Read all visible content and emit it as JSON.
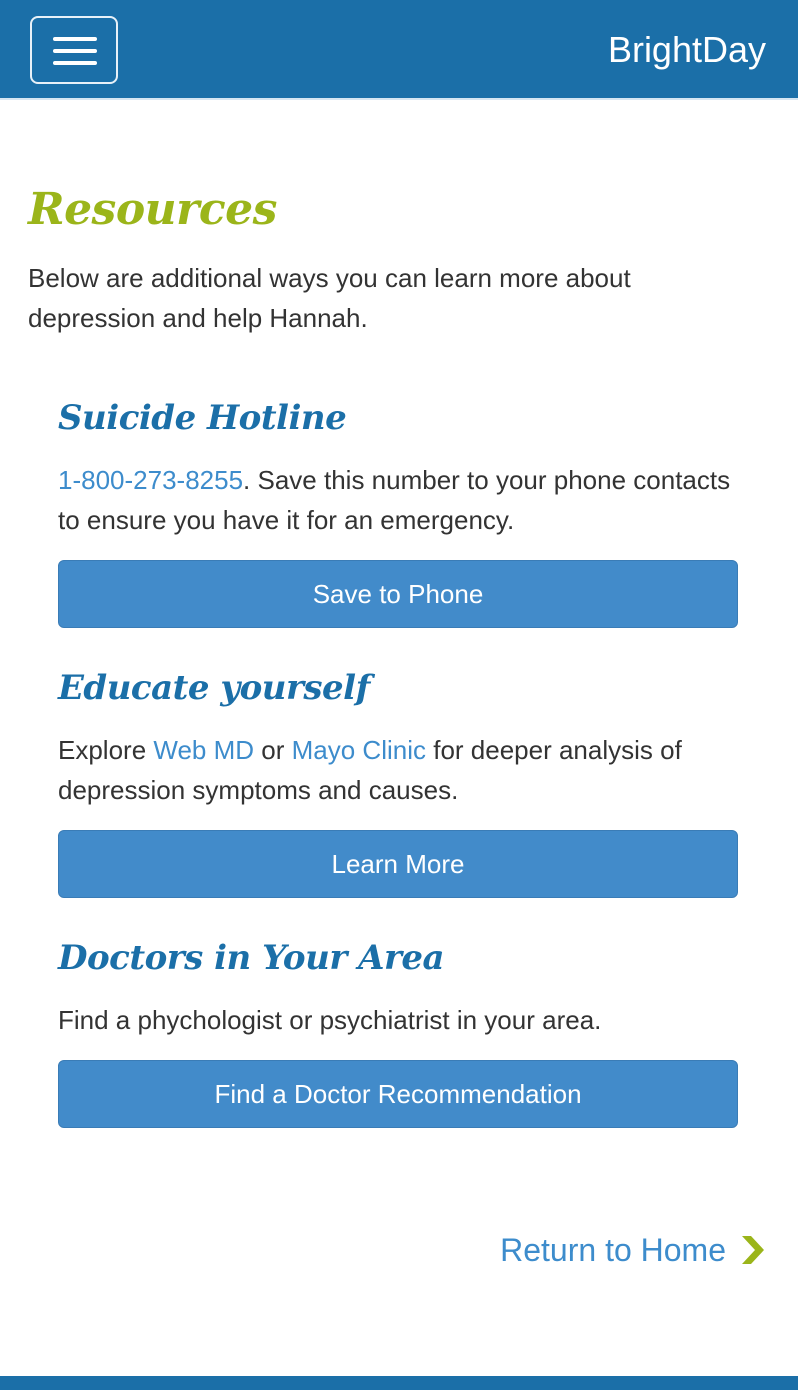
{
  "header": {
    "brand": "BrightDay",
    "menu_icon": "hamburger-menu-icon"
  },
  "main": {
    "title": "Resources",
    "intro": "Below are additional ways you can learn more about depression and help Hannah."
  },
  "sections": [
    {
      "heading": "Suicide Hotline",
      "phone_link": "1-800-273-8255",
      "text_after_link": ". Save this number to your phone contacts to ensure you have it for an emergency.",
      "button_label": "Save to Phone"
    },
    {
      "heading": "Educate yourself",
      "text_before": "Explore ",
      "link1": "Web MD",
      "text_between": " or ",
      "link2": "Mayo Clinic",
      "text_after": " for deeper analysis of depression symptoms and causes.",
      "button_label": "Learn More"
    },
    {
      "heading": "Doctors in Your Area",
      "text": "Find a phychologist or psychiatrist in your area.",
      "button_label": "Find a Doctor Recommendation"
    }
  ],
  "footer": {
    "return_label": "Return to Home",
    "return_icon": "chevron-right-icon"
  },
  "colors": {
    "primary": "#1b6fa8",
    "accent_green": "#9bb51a",
    "button": "#428bca",
    "link": "#3d8ccc"
  }
}
